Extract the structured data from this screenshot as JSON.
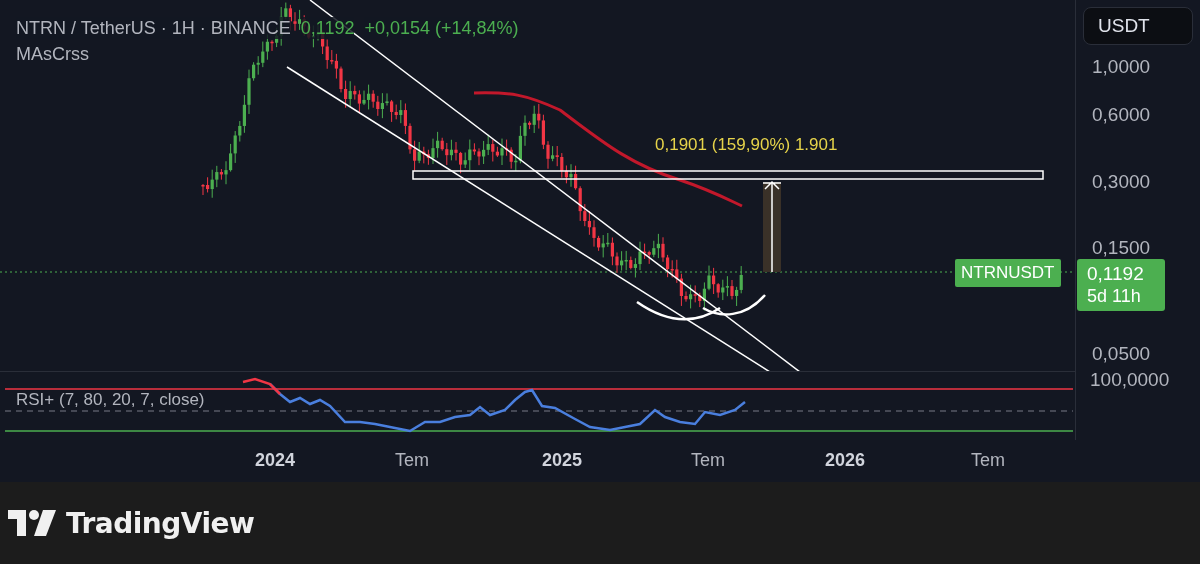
{
  "header": {
    "symbol": "NTRN / TetherUS · 1H · BINANCE",
    "price": "0,1192",
    "change": "+0,0154 (+14,84%)",
    "indicator": "MAsCrss"
  },
  "currency_button": "USDT",
  "annotation": "0,1901 (159,90%) 1.901",
  "price_axis": [
    "1,0000",
    "0,6000",
    "0,3000",
    "0,1500",
    "0,0500"
  ],
  "symbol_label": "NTRNUSDT",
  "last_price": "0,1192",
  "countdown": "5d 11h",
  "rsi": {
    "label": "RSI+ (7, 80, 20, 7, close)",
    "axis_label": "100,0000"
  },
  "time_axis": [
    {
      "label": "2024",
      "kind": "year"
    },
    {
      "label": "Tem",
      "kind": "month"
    },
    {
      "label": "2025",
      "kind": "year"
    },
    {
      "label": "Tem",
      "kind": "month"
    },
    {
      "label": "2026",
      "kind": "year"
    },
    {
      "label": "Tem",
      "kind": "month"
    }
  ],
  "brand": "TradingView"
}
